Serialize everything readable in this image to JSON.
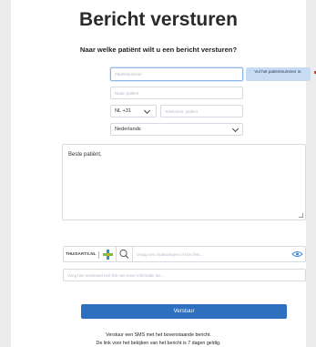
{
  "title": "Bericht versturen",
  "question": "Naar welke patiënt wilt u een bericht versturen?",
  "form": {
    "patient_number_placeholder": "Patiëntnummer",
    "patient_name_placeholder": "Naam patiënt",
    "country_code": "NL +31",
    "phone_placeholder": "Telefoonnr. patiënt",
    "language": "Nederlands",
    "tooltip": "Vul het patiëntnummer in."
  },
  "message": {
    "text": "Beste patiënt,"
  },
  "info": {
    "brand": "THUISARTS.NL",
    "search_placeholder": "Vraag een onderwerpen of kies hier...",
    "extra_placeholder": "Voeg hier eventueel een link met meer informatie toe..."
  },
  "send_button": "Verstuur",
  "notes": {
    "line1": "Verstuur een SMS met het bovenstaande bericht.",
    "line2": "De link voor het bekijken van het bericht is 7 dagen geldig."
  },
  "colors": {
    "primary": "#2f6fbf",
    "tooltip_bg": "#c7dcf2",
    "required": "#d83b3b",
    "cross_green": "#7fbf3f",
    "cross_blue": "#2f8fd6"
  }
}
